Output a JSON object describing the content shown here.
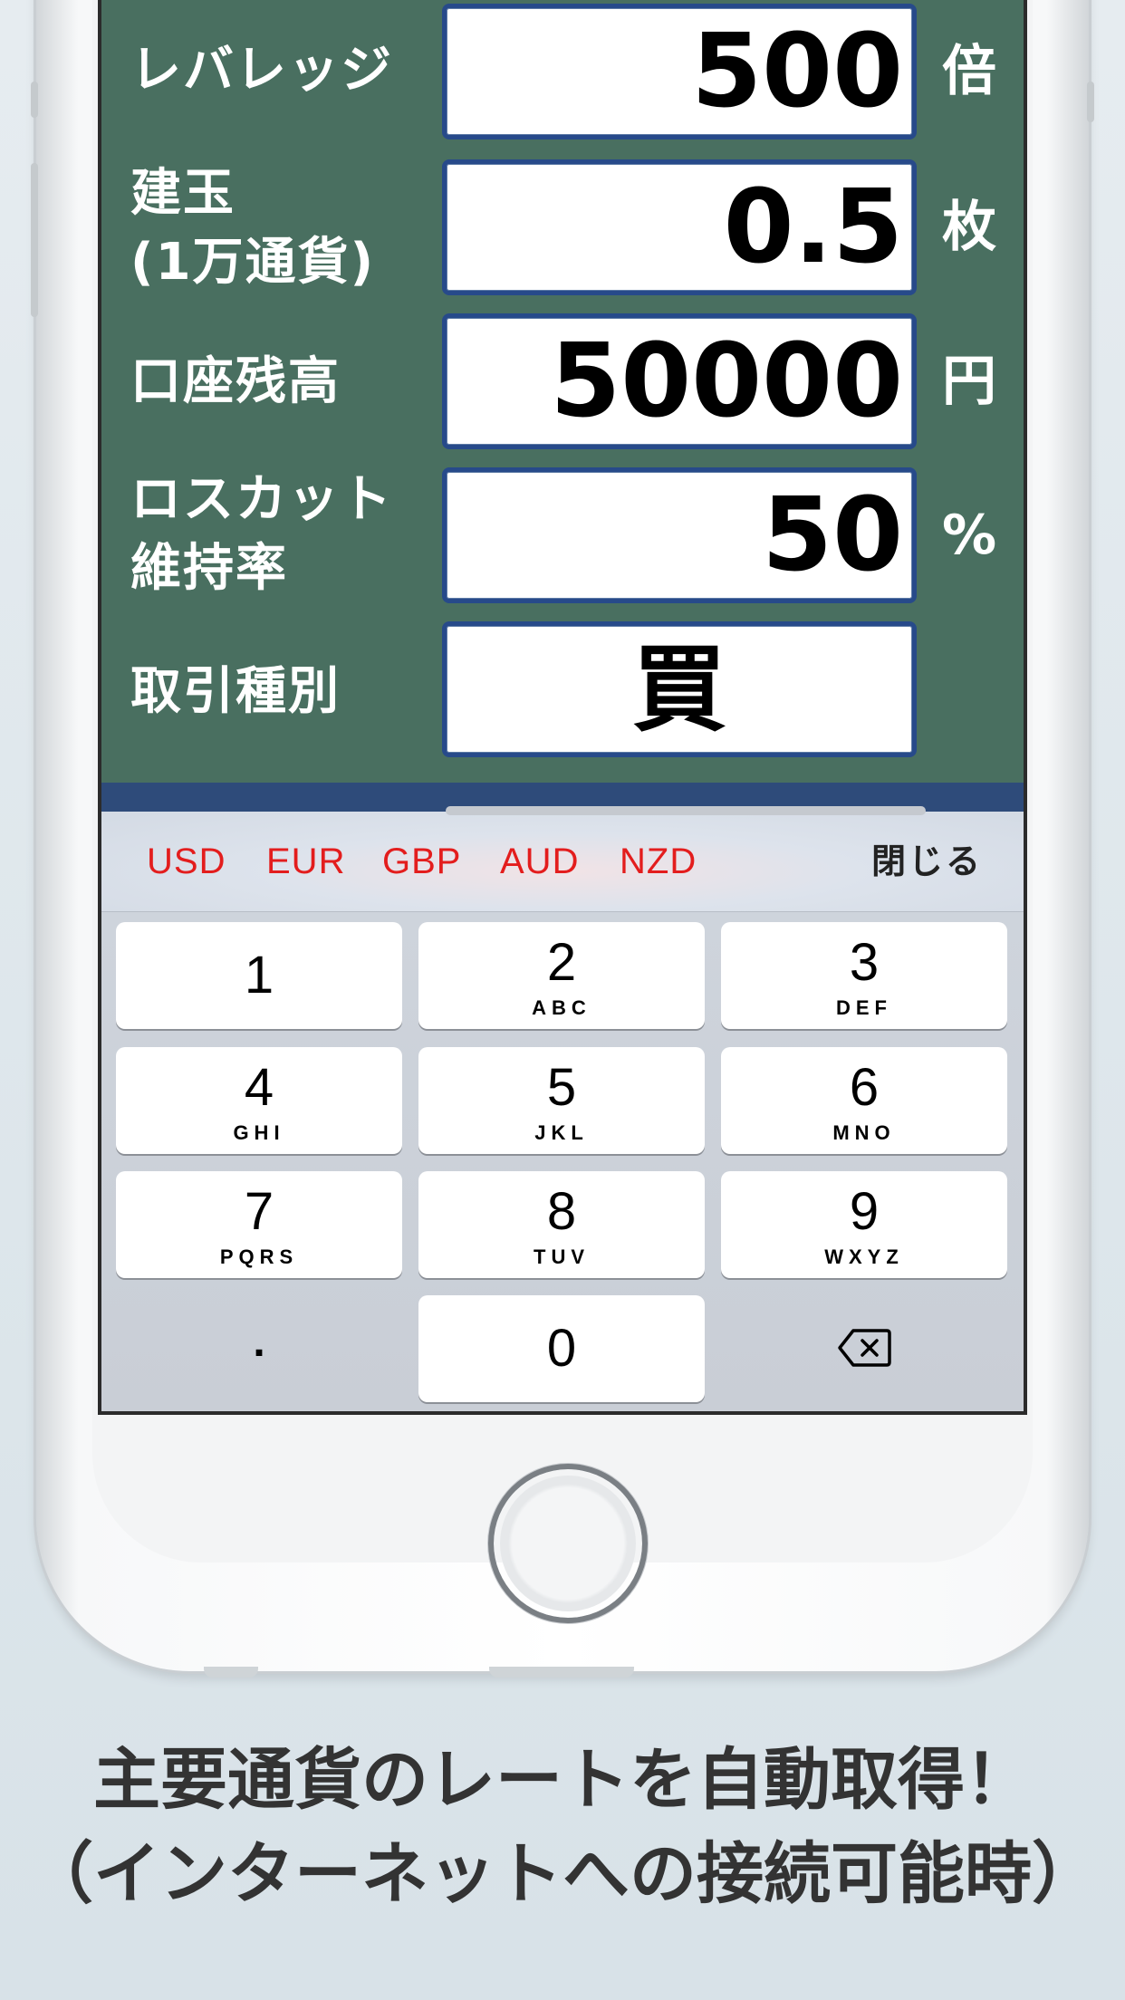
{
  "form": {
    "leverage": {
      "label": "レバレッジ",
      "value": "500",
      "unit": "倍"
    },
    "position": {
      "label_line1": "建玉",
      "label_line2": "(1万通貨)",
      "value": "0.5",
      "unit": "枚"
    },
    "balance": {
      "label": "口座残高",
      "value": "50000",
      "unit": "円"
    },
    "losscut": {
      "label_line1": "ロスカット",
      "label_line2": "維持率",
      "value": "50",
      "unit": "%"
    },
    "trade_type": {
      "label": "取引種別",
      "value": "買"
    }
  },
  "accessory_bar": {
    "currencies": [
      "USD",
      "EUR",
      "GBP",
      "AUD",
      "NZD"
    ],
    "close_label": "閉じる"
  },
  "keypad": {
    "keys": [
      {
        "num": "1",
        "letters": ""
      },
      {
        "num": "2",
        "letters": "ABC"
      },
      {
        "num": "3",
        "letters": "DEF"
      },
      {
        "num": "4",
        "letters": "GHI"
      },
      {
        "num": "5",
        "letters": "JKL"
      },
      {
        "num": "6",
        "letters": "MNO"
      },
      {
        "num": "7",
        "letters": "PQRS"
      },
      {
        "num": "8",
        "letters": "TUV"
      },
      {
        "num": "9",
        "letters": "WXYZ"
      },
      {
        "num": "0",
        "letters": ""
      }
    ],
    "decimal": ".",
    "delete_icon": "backspace-icon"
  },
  "caption": {
    "line1": "主要通貨のレートを自動取得！",
    "line2": "（インターネットへの接続可能時）"
  },
  "colors": {
    "form_bg": "#496f60",
    "field_border": "#274a8a",
    "currency_text": "#e31d1d",
    "caption_text": "#333333"
  }
}
